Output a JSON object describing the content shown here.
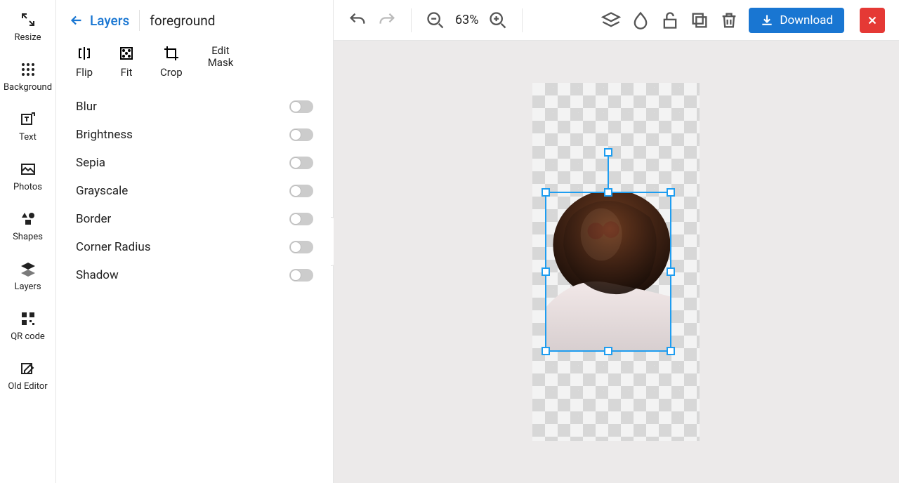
{
  "sidebar": {
    "items": [
      {
        "icon": "resize-icon",
        "label": "Resize"
      },
      {
        "icon": "grid-dots-icon",
        "label": "Background"
      },
      {
        "icon": "text-add-icon",
        "label": "Text"
      },
      {
        "icon": "image-icon",
        "label": "Photos"
      },
      {
        "icon": "shapes-icon",
        "label": "Shapes"
      },
      {
        "icon": "layers-icon",
        "label": "Layers"
      },
      {
        "icon": "qrcode-icon",
        "label": "QR code"
      },
      {
        "icon": "edit-icon",
        "label": "Old Editor"
      }
    ]
  },
  "panel": {
    "back_label": "Layers",
    "layer_name": "foreground",
    "transform": [
      {
        "icon": "flip-h-icon",
        "label": "Flip"
      },
      {
        "icon": "fit-icon",
        "label": "Fit"
      },
      {
        "icon": "crop-icon",
        "label": "Crop"
      },
      {
        "icon": "",
        "label": "Edit Mask"
      }
    ],
    "effects": [
      {
        "label": "Blur",
        "on": false
      },
      {
        "label": "Brightness",
        "on": false
      },
      {
        "label": "Sepia",
        "on": false
      },
      {
        "label": "Grayscale",
        "on": false
      },
      {
        "label": "Border",
        "on": false
      },
      {
        "label": "Corner Radius",
        "on": false
      },
      {
        "label": "Shadow",
        "on": false
      }
    ]
  },
  "topbar": {
    "zoom": "63%",
    "download": "Download"
  },
  "colors": {
    "accent": "#1976d2",
    "selection": "#1e9df0",
    "danger": "#e53935"
  }
}
